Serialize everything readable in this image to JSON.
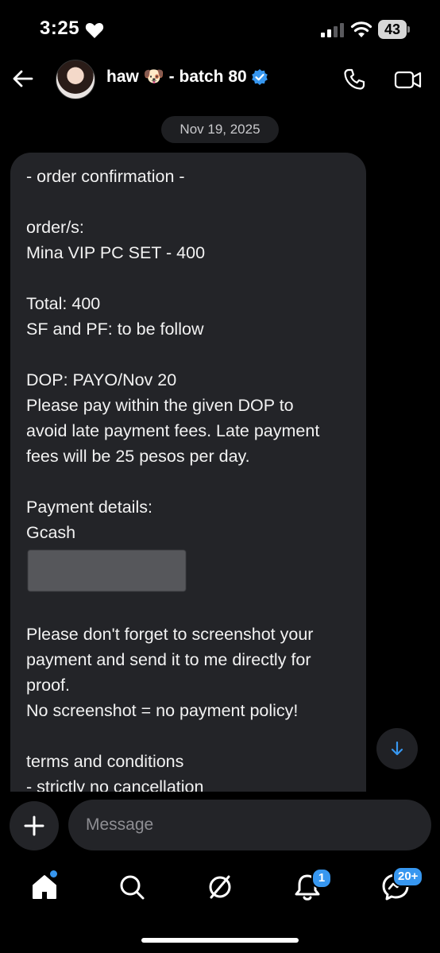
{
  "status_bar": {
    "time": "3:25",
    "battery": "43"
  },
  "header": {
    "title": "haw 🐶 - batch 80",
    "verified": true,
    "icons": [
      "back-arrow-icon",
      "phone-icon",
      "video-icon",
      "verified-badge-icon"
    ]
  },
  "chat": {
    "date": "Nov 19, 2025",
    "message_lines": [
      "- order confirmation -",
      "",
      "order/s:",
      "Mina VIP PC SET - 400",
      "",
      "Total: 400",
      "SF and PF: to be follow",
      "",
      "DOP: PAYO/Nov 20",
      "Please pay within the given DOP to",
      "avoid late payment fees. Late payment",
      "fees will be 25 pesos per day.",
      "",
      "Payment details:",
      "Gcash",
      "",
      "",
      "",
      "Please don't forget to screenshot your",
      "payment and send it to me directly for",
      "proof.",
      "No screenshot = no payment policy!",
      "",
      "terms and conditions",
      "- strictly no cancellation"
    ]
  },
  "composer": {
    "placeholder": "Message"
  },
  "tab_bar": {
    "notifications_badge": "1",
    "messages_badge": "20+"
  },
  "colors": {
    "accent": "#3797f0",
    "bubble": "#232428",
    "background": "#000000"
  }
}
